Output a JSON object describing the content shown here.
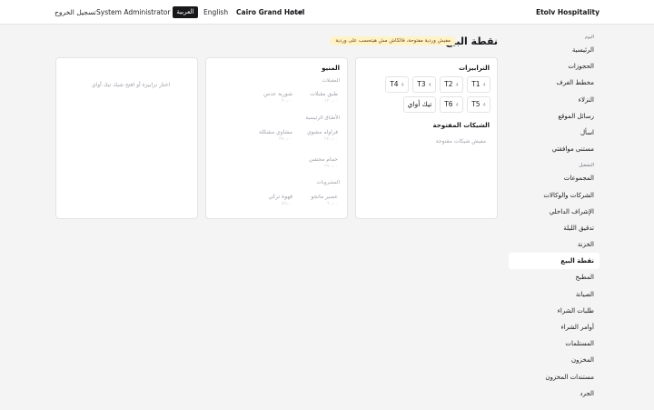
{
  "header": {
    "brand": "Etolv Hospitality",
    "hotel_label": "الفندق",
    "hotel_name": "Cairo Grand Hotel",
    "lang_en": "English",
    "lang_ar": "العربية",
    "user": "System Administrator",
    "logout": "تسجيل الخروج"
  },
  "sidebar": {
    "section_today": "اليوم",
    "today_items": [
      "الرئيسية",
      "الحجوزات",
      "مخطط الغرف",
      "النزلاء",
      "رسائل الموقع",
      "اسأل",
      "مستنى موافقتي"
    ],
    "section_ops": "التشغيل",
    "ops_items": [
      "المجموعات",
      "الشركات والوكالات",
      "الإشراف الداخلي",
      "تدقيق الليلة",
      "الخزنة",
      "نقطة البيع",
      "المطبخ",
      "الصيانة",
      "طلبات الشراء",
      "أوامر الشراء",
      "المستلمات",
      "المخزون",
      "مستندات المخزون",
      "الجرد"
    ],
    "active": "نقطة البيع"
  },
  "page": {
    "title": "نقطة البيع",
    "warning": "مفيش وردية مفتوحة، فالكاش مش هيتحسب على وردية"
  },
  "tables_card": {
    "title": "الترابيزات",
    "tables": [
      {
        "name": "T1",
        "seats": "4"
      },
      {
        "name": "T2",
        "seats": "4"
      },
      {
        "name": "T3",
        "seats": "4"
      },
      {
        "name": "T4",
        "seats": "4"
      },
      {
        "name": "T5",
        "seats": "4"
      },
      {
        "name": "T6",
        "seats": "4"
      },
      {
        "name": "تيك أواي",
        "seats": ""
      }
    ],
    "checks_title": "الشيكات المفتوحة",
    "checks_empty": "مفيش شيكات مفتوحة"
  },
  "menu_card": {
    "title": "المنيو",
    "categories": [
      {
        "name": "المقبلات",
        "items": [
          {
            "name": "طبق مقبلات",
            "price": "١٢٠٫٠٠"
          },
          {
            "name": "شوربة عدس",
            "price": "٧٠٫٠٠"
          }
        ]
      },
      {
        "name": "الأطباق الرئيسية",
        "items": [
          {
            "name": "فراوله مشوي",
            "price": "٢٤٠٫٠٠"
          },
          {
            "name": "مشاوي مشكلة",
            "price": "٣٨٠٫٠٠"
          },
          {
            "name": "حمام محشي",
            "price": "٢٩٠٫٠٠"
          }
        ]
      },
      {
        "name": "المشروبات",
        "items": [
          {
            "name": "عصير مانجو",
            "price": "٦٠٫٠٠"
          },
          {
            "name": "قهوة تركي",
            "price": "٤٥٫٠٠"
          }
        ]
      }
    ]
  },
  "order_card": {
    "empty": "اختار ترابيزة أو افتح شيك تيك أواي"
  }
}
